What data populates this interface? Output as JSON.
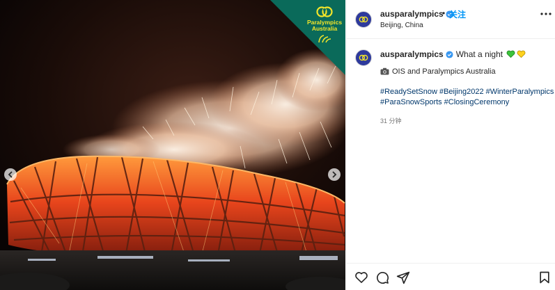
{
  "post": {
    "header": {
      "username": "ausparalympics",
      "separator": "•",
      "follow_label": "关注",
      "location": "Beijing, China"
    },
    "caption": {
      "username": "ausparalympics",
      "text": "What a night",
      "emojis": [
        "green-heart-icon",
        "yellow-heart-icon"
      ],
      "credit": "OIS and Paralympics Australia",
      "hashtags": [
        "#ReadySetSnow",
        "#Beijing2022",
        "#WinterParalympics",
        "#ParaSnowSports",
        "#ClosingCeremony"
      ],
      "timestamp": "31 分钟"
    },
    "media": {
      "brand_line1": "Paralympics",
      "brand_line2": "Australia"
    }
  },
  "colors": {
    "link_blue": "#0095f6",
    "hashtag": "#00376b",
    "verified": "#3897f0",
    "banner_green": "#0a6a5a",
    "brand_yellow": "#f2e52a"
  }
}
